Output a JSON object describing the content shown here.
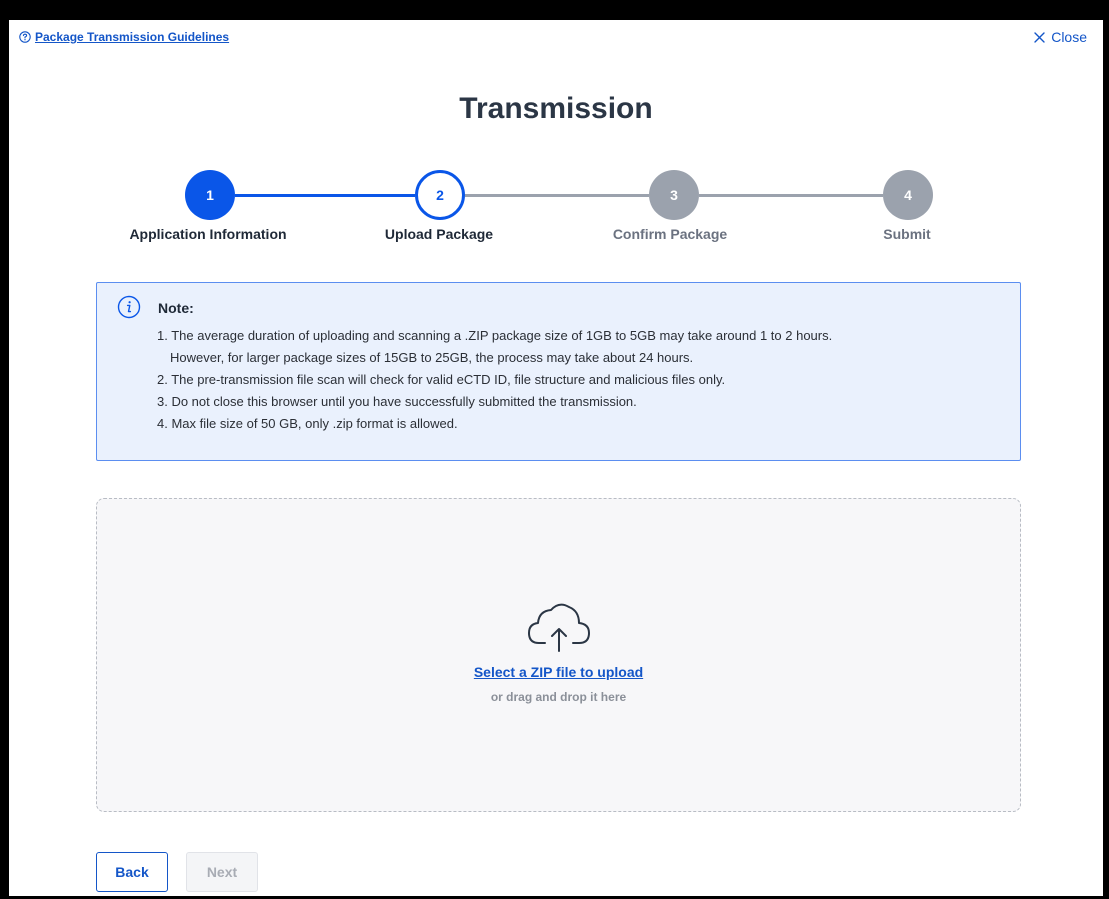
{
  "header": {
    "guidelines_label": "Package Transmission Guidelines",
    "close_label": "Close"
  },
  "page": {
    "title": "Transmission"
  },
  "stepper": {
    "steps": [
      {
        "number": "1",
        "label": "Application Information",
        "state": "done"
      },
      {
        "number": "2",
        "label": "Upload Package",
        "state": "active"
      },
      {
        "number": "3",
        "label": "Confirm Package",
        "state": "pending"
      },
      {
        "number": "4",
        "label": "Submit",
        "state": "pending"
      }
    ]
  },
  "note": {
    "title": "Note:",
    "lines": [
      "1. The average duration of uploading and scanning a .ZIP package size of 1GB to 5GB may take around 1 to 2 hours.",
      "However, for larger package sizes of 15GB to 25GB, the process may take about 24 hours.",
      "2. The pre-transmission file scan will check for valid eCTD ID, file structure and malicious files only.",
      "3. Do not close this browser until you have successfully submitted the transmission.",
      "4. Max file size of 50 GB, only .zip format is allowed."
    ]
  },
  "upload": {
    "select_label": "Select a ZIP file to upload",
    "drag_label": "or drag and drop it here"
  },
  "footer": {
    "back_label": "Back",
    "next_label": "Next"
  },
  "colors": {
    "primary": "#0a56e8",
    "link": "#1456c8",
    "pending": "#9ba2ad",
    "note_bg": "#eaf1fd",
    "note_border": "#5b8ef0"
  }
}
